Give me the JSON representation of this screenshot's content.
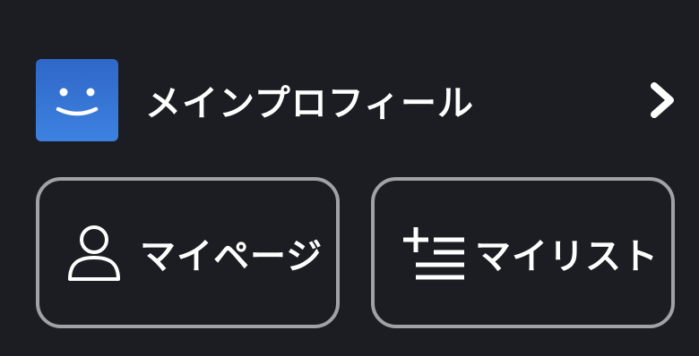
{
  "profile": {
    "name": "メインプロフィール",
    "avatar_color": "#3578d6"
  },
  "actions": {
    "mypage_label": "マイページ",
    "mylist_label": "マイリスト"
  },
  "colors": {
    "background": "#1c1d22",
    "card_border": "#a1a2a6",
    "text": "#ffffff"
  },
  "icons": {
    "avatar": "smiley-face-icon",
    "chevron": "chevron-right-icon",
    "mypage": "person-icon",
    "mylist": "add-to-list-icon"
  }
}
